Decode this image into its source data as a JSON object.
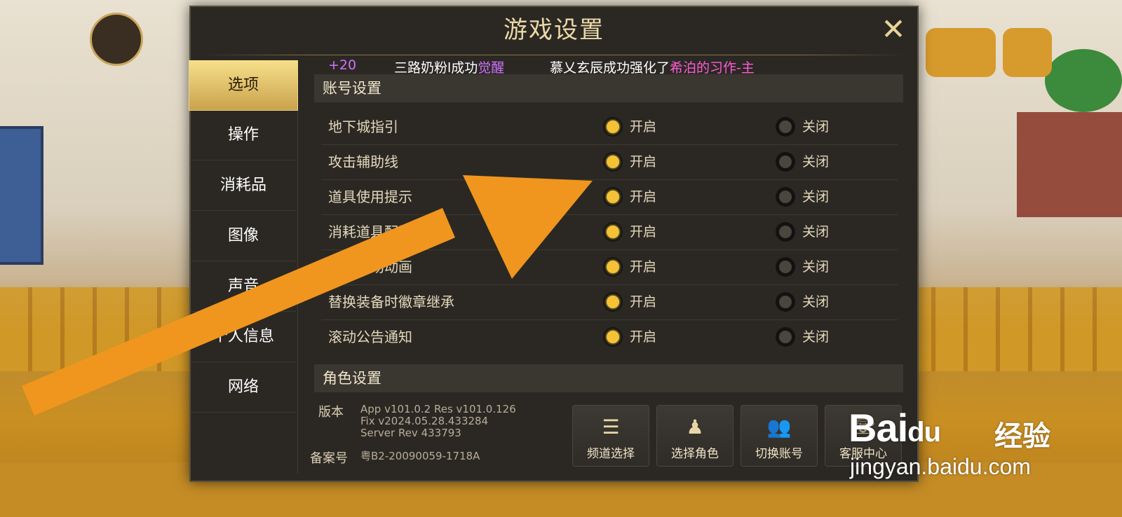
{
  "dialog": {
    "title": "游戏设置",
    "close_icon": "close-x-icon"
  },
  "ticker": {
    "plus": "+20",
    "msg1_a": "三路奶粉l成功",
    "msg1_b": "觉醒",
    "msg2_a": "慕乂玄辰成功强化了",
    "msg2_b": "希泊的习作-主"
  },
  "sidebar": {
    "items": [
      {
        "label": "选项",
        "active": true
      },
      {
        "label": "操作"
      },
      {
        "label": "消耗品"
      },
      {
        "label": "图像"
      },
      {
        "label": "声音"
      },
      {
        "label": "个人信息"
      },
      {
        "label": "网络"
      }
    ]
  },
  "account_section": {
    "header": "账号设置",
    "rows": [
      {
        "label": "地下城指引",
        "on": "开启",
        "off": "关闭",
        "value": "on"
      },
      {
        "label": "攻击辅助线",
        "on": "开启",
        "off": "关闭",
        "value": "on"
      },
      {
        "label": "道具使用提示",
        "on": "开启",
        "off": "关闭",
        "value": "on"
      },
      {
        "label": "消耗道具配置提示",
        "on": "开启",
        "off": "关闭",
        "value": "on"
      },
      {
        "label": "跳过过场动画",
        "on": "开启",
        "off": "关闭",
        "value": "on"
      },
      {
        "label": "替换装备时徽章继承",
        "on": "开启",
        "off": "关闭",
        "value": "on"
      },
      {
        "label": "滚动公告通知",
        "on": "开启",
        "off": "关闭",
        "value": "on"
      }
    ]
  },
  "character_section": {
    "header": "角色设置"
  },
  "version": {
    "label": "版本",
    "line1": "App v101.0.2 Res v101.0.126",
    "line2": "Fix v2024.05.28.433284",
    "line3": "Server Rev 433793"
  },
  "record": {
    "label": "备案号",
    "value": "粤B2-20090059-1718A"
  },
  "buttons": [
    {
      "label": "频道选择",
      "icon": "list-icon"
    },
    {
      "label": "选择角色",
      "icon": "person-icon"
    },
    {
      "label": "切换账号",
      "icon": "group-icon"
    },
    {
      "label": "客服中心",
      "icon": "headset-icon"
    }
  ],
  "watermark": {
    "brand": "Bai",
    "brand2": "du",
    "cn": "经验",
    "url": "jingyan.baidu.com"
  },
  "colors": {
    "accent_gold": "#f5c235",
    "arrow_orange": "#f0961e",
    "ticker_purple": "#d070ff",
    "ticker_pink": "#ff5bd6"
  }
}
